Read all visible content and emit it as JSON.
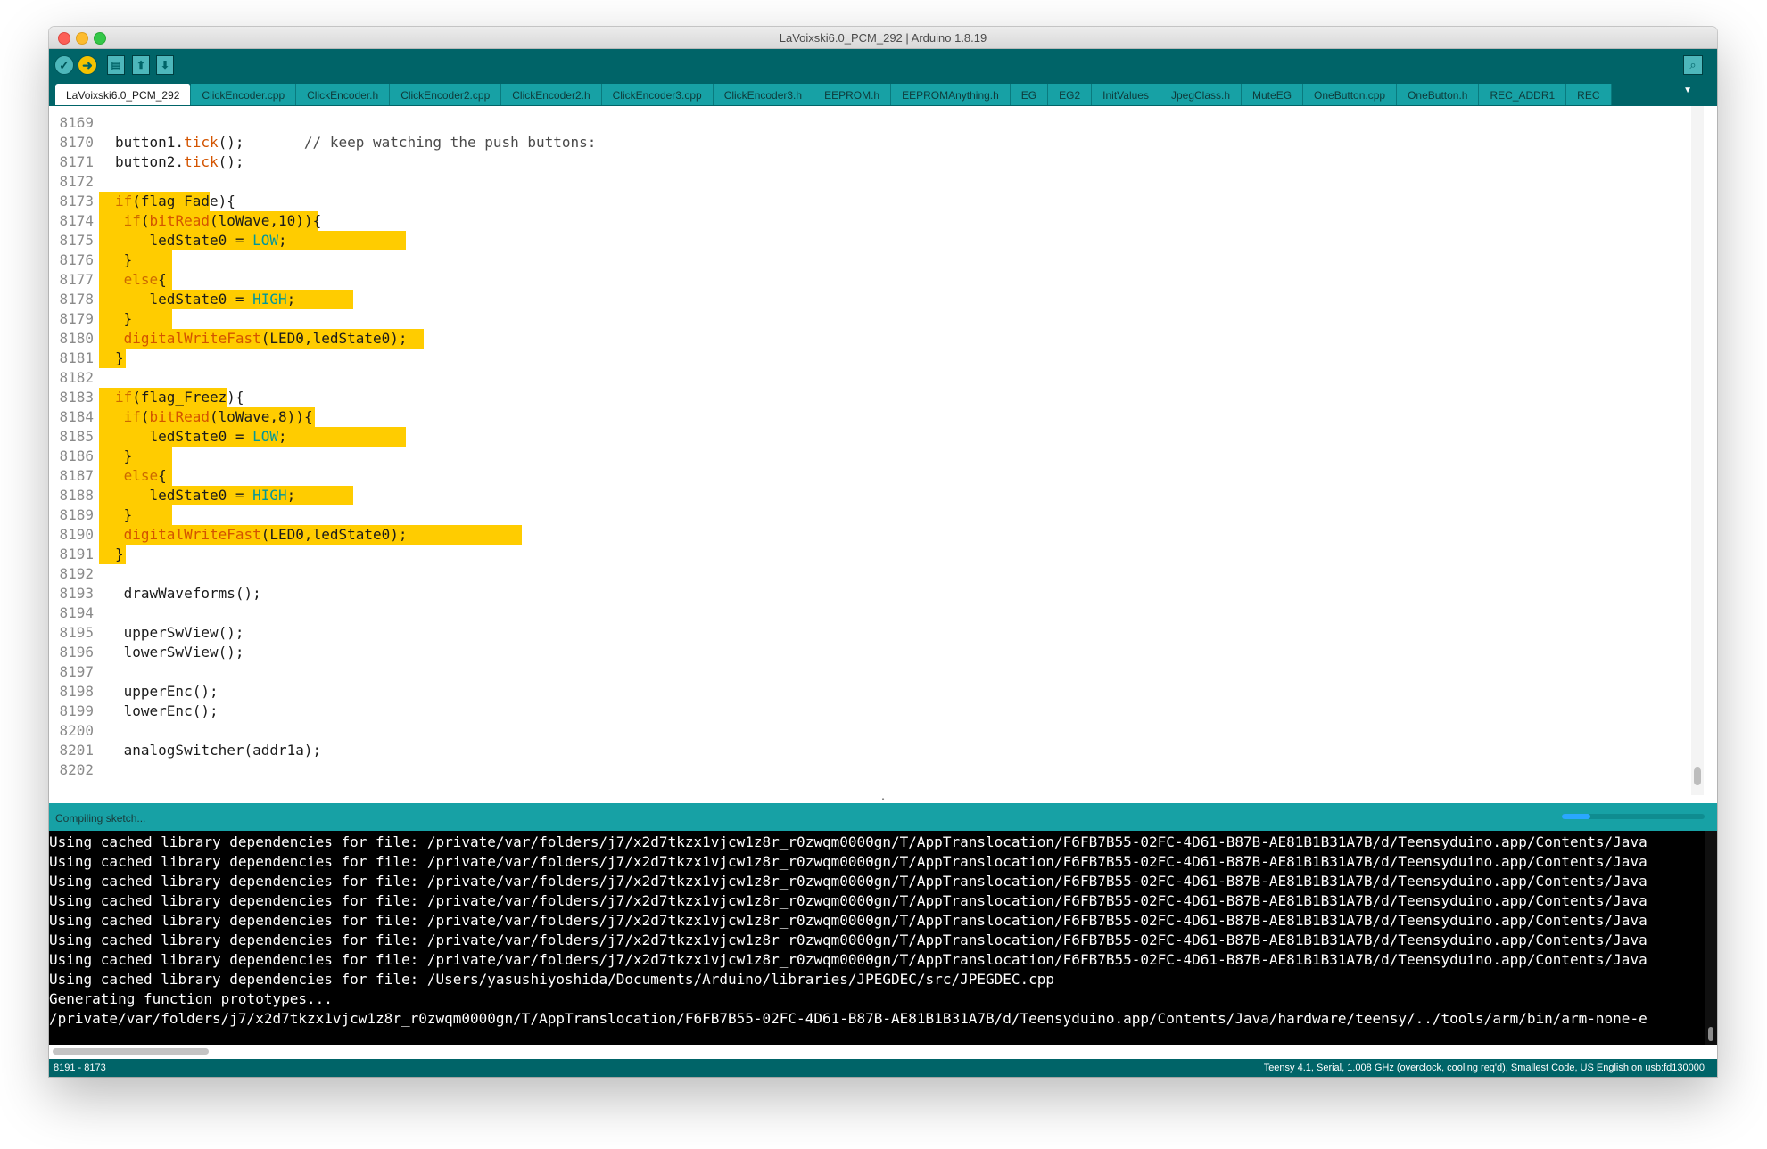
{
  "window": {
    "title": "LaVoixski6.0_PCM_292 | Arduino 1.8.19"
  },
  "toolbar": {
    "verify_icon": "checkmark-icon",
    "upload_icon": "right-arrow-icon",
    "new_icon": "new-file-icon",
    "open_icon": "open-icon",
    "save_icon": "save-icon",
    "serial_monitor_icon": "magnifier-icon"
  },
  "tabs": [
    "LaVoixski6.0_PCM_292",
    "ClickEncoder.cpp",
    "ClickEncoder.h",
    "ClickEncoder2.cpp",
    "ClickEncoder2.h",
    "ClickEncoder3.cpp",
    "ClickEncoder3.h",
    "EEPROM.h",
    "EEPROMAnything.h",
    "EG",
    "EG2",
    "InitValues",
    "JpegClass.h",
    "MuteEG",
    "OneButton.cpp",
    "OneButton.h",
    "REC_ADDR1",
    "REC"
  ],
  "editor": {
    "lines": [
      {
        "num": "8169",
        "text": ""
      },
      {
        "num": "8170",
        "text": "button1.tick();       // keep watching the push buttons:"
      },
      {
        "num": "8171",
        "text": "button2.tick();"
      },
      {
        "num": "8172",
        "text": ""
      },
      {
        "num": "8173",
        "text": "if(flag_Fade){"
      },
      {
        "num": "8174",
        "text": " if(bitRead(loWave,10)){"
      },
      {
        "num": "8175",
        "text": "    ledState0 = LOW;"
      },
      {
        "num": "8176",
        "text": " }"
      },
      {
        "num": "8177",
        "text": " else{"
      },
      {
        "num": "8178",
        "text": "    ledState0 = HIGH;"
      },
      {
        "num": "8179",
        "text": " }"
      },
      {
        "num": "8180",
        "text": " digitalWriteFast(LED0,ledState0);"
      },
      {
        "num": "8181",
        "text": "}"
      },
      {
        "num": "8182",
        "text": ""
      },
      {
        "num": "8183",
        "text": "if(flag_Freez){"
      },
      {
        "num": "8184",
        "text": " if(bitRead(loWave,8)){"
      },
      {
        "num": "8185",
        "text": "    ledState0 = LOW;"
      },
      {
        "num": "8186",
        "text": " }"
      },
      {
        "num": "8187",
        "text": " else{"
      },
      {
        "num": "8188",
        "text": "    ledState0 = HIGH;"
      },
      {
        "num": "8189",
        "text": " }"
      },
      {
        "num": "8190",
        "text": " digitalWriteFast(LED0,ledState0);"
      },
      {
        "num": "8191",
        "text": "}"
      },
      {
        "num": "8192",
        "text": ""
      },
      {
        "num": "8193",
        "text": " drawWaveforms();"
      },
      {
        "num": "8194",
        "text": ""
      },
      {
        "num": "8195",
        "text": " upperSwView();"
      },
      {
        "num": "8196",
        "text": " lowerSwView();"
      },
      {
        "num": "8197",
        "text": ""
      },
      {
        "num": "8198",
        "text": " upperEnc();"
      },
      {
        "num": "8199",
        "text": " lowerEnc();"
      },
      {
        "num": "8200",
        "text": ""
      },
      {
        "num": "8201",
        "text": " analogSwitcher(addr1a);"
      },
      {
        "num": "8202",
        "text": ""
      }
    ]
  },
  "status": {
    "message": "Compiling sketch...",
    "progress_fraction": 0.2
  },
  "console": {
    "lines": [
      "Using cached library dependencies for file: /private/var/folders/j7/x2d7tkzx1vjcw1z8r_r0zwqm0000gn/T/AppTranslocation/F6FB7B55-02FC-4D61-B87B-AE81B1B31A7B/d/Teensyduino.app/Contents/Java",
      "Using cached library dependencies for file: /private/var/folders/j7/x2d7tkzx1vjcw1z8r_r0zwqm0000gn/T/AppTranslocation/F6FB7B55-02FC-4D61-B87B-AE81B1B31A7B/d/Teensyduino.app/Contents/Java",
      "Using cached library dependencies for file: /private/var/folders/j7/x2d7tkzx1vjcw1z8r_r0zwqm0000gn/T/AppTranslocation/F6FB7B55-02FC-4D61-B87B-AE81B1B31A7B/d/Teensyduino.app/Contents/Java",
      "Using cached library dependencies for file: /private/var/folders/j7/x2d7tkzx1vjcw1z8r_r0zwqm0000gn/T/AppTranslocation/F6FB7B55-02FC-4D61-B87B-AE81B1B31A7B/d/Teensyduino.app/Contents/Java",
      "Using cached library dependencies for file: /private/var/folders/j7/x2d7tkzx1vjcw1z8r_r0zwqm0000gn/T/AppTranslocation/F6FB7B55-02FC-4D61-B87B-AE81B1B31A7B/d/Teensyduino.app/Contents/Java",
      "Using cached library dependencies for file: /private/var/folders/j7/x2d7tkzx1vjcw1z8r_r0zwqm0000gn/T/AppTranslocation/F6FB7B55-02FC-4D61-B87B-AE81B1B31A7B/d/Teensyduino.app/Contents/Java",
      "Using cached library dependencies for file: /private/var/folders/j7/x2d7tkzx1vjcw1z8r_r0zwqm0000gn/T/AppTranslocation/F6FB7B55-02FC-4D61-B87B-AE81B1B31A7B/d/Teensyduino.app/Contents/Java",
      "Using cached library dependencies for file: /Users/yasushiyoshida/Documents/Arduino/libraries/JPEGDEC/src/JPEGDEC.cpp",
      "Generating function prototypes...",
      "/private/var/folders/j7/x2d7tkzx1vjcw1z8r_r0zwqm0000gn/T/AppTranslocation/F6FB7B55-02FC-4D61-B87B-AE81B1B31A7B/d/Teensyduino.app/Contents/Java/hardware/teensy/../tools/arm/bin/arm-none-e"
    ]
  },
  "footer": {
    "line_range": "8191 - 8173",
    "board_info": "Teensy 4.1, Serial, 1.008 GHz (overclock, cooling req'd), Smallest Code, US English on usb:fd130000"
  },
  "colors": {
    "toolbar": "#006468",
    "tab": "#17a1a5",
    "highlight": "#ffcc00",
    "keyword": "#cc6a00",
    "constant": "#00979c",
    "console_bg": "#000000"
  }
}
